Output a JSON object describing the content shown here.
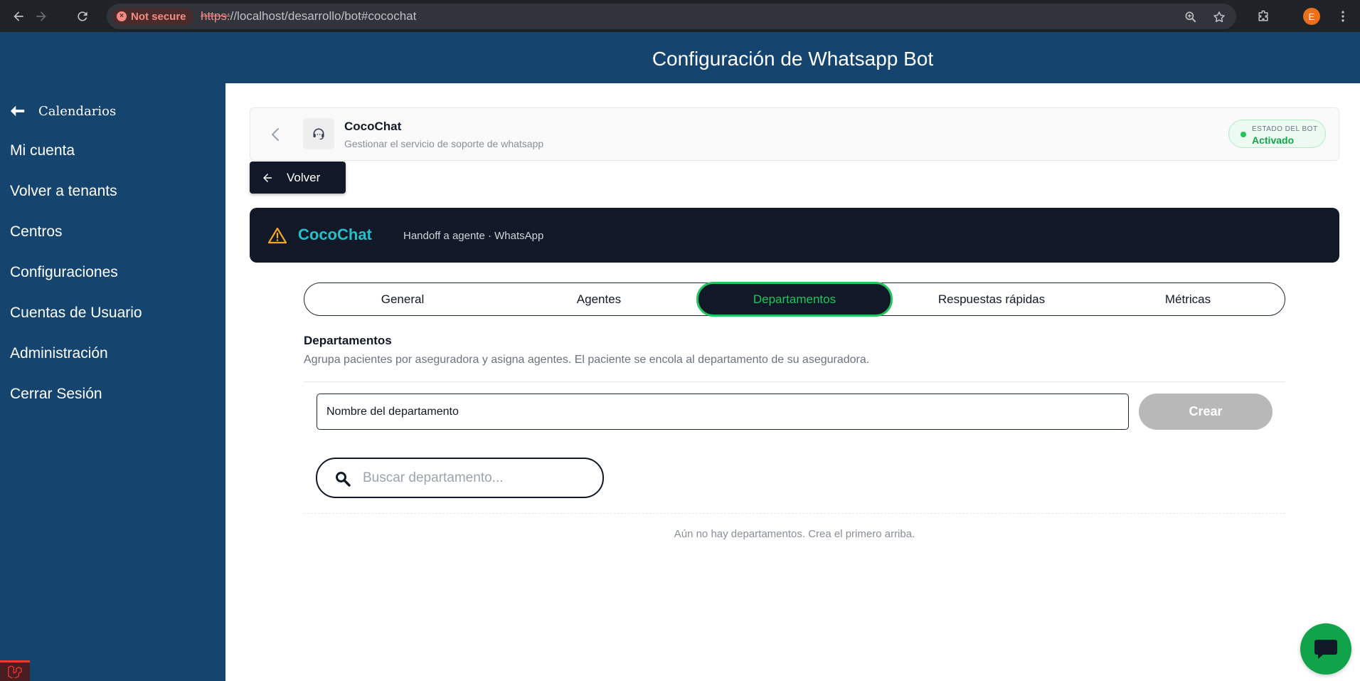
{
  "browser": {
    "security_label": "Not secure",
    "url_scheme": "https:",
    "url_rest": "//localhost/desarrollo/bot#cocochat",
    "profile_initial": "E"
  },
  "header": {
    "title": "Configuración de Whatsapp Bot"
  },
  "sidebar": {
    "back_label": "Calendarios",
    "items": [
      {
        "label": "Mi cuenta"
      },
      {
        "label": "Volver a tenants"
      },
      {
        "label": "Centros"
      },
      {
        "label": "Configuraciones"
      },
      {
        "label": "Cuentas de Usuario"
      },
      {
        "label": "Administración"
      },
      {
        "label": "Cerrar Sesión"
      }
    ]
  },
  "bot_card": {
    "name": "CocoChat",
    "description": "Gestionar el servicio de soporte de whatsapp",
    "status_label": "ESTADO DEL BOT",
    "status_value": "Activado",
    "status_color": "#16a34a"
  },
  "volver_label": "Volver",
  "banner": {
    "brand": "CocoChat",
    "subtitle": "Handoff a agente · WhatsApp",
    "brand_color": "#22c1c9",
    "warning_color": "#f5a623"
  },
  "tabs": [
    {
      "label": "General",
      "active": false
    },
    {
      "label": "Agentes",
      "active": false
    },
    {
      "label": "Departamentos",
      "active": true
    },
    {
      "label": "Respuestas rápidas",
      "active": false
    },
    {
      "label": "Métricas",
      "active": false
    }
  ],
  "section": {
    "title": "Departamentos",
    "description": "Agrupa pacientes por aseguradora y asigna agentes. El paciente se encola al departamento de su aseguradora."
  },
  "form": {
    "input_value": "",
    "input_placeholder": "Nombre del departamento",
    "create_label": "Crear"
  },
  "search": {
    "value": "",
    "placeholder": "Buscar departamento..."
  },
  "empty_message": "Aún no hay departamentos. Crea el primero arriba.",
  "colors": {
    "brand_blue": "#15456f",
    "accent_green": "#22c55e",
    "dark": "#111827"
  },
  "icons": {
    "back": "arrow-left-icon",
    "chevron": "chevron-left-icon",
    "bot": "headset-icon",
    "warning": "warning-icon",
    "search": "search-icon",
    "chat": "chat-bubble-icon"
  }
}
